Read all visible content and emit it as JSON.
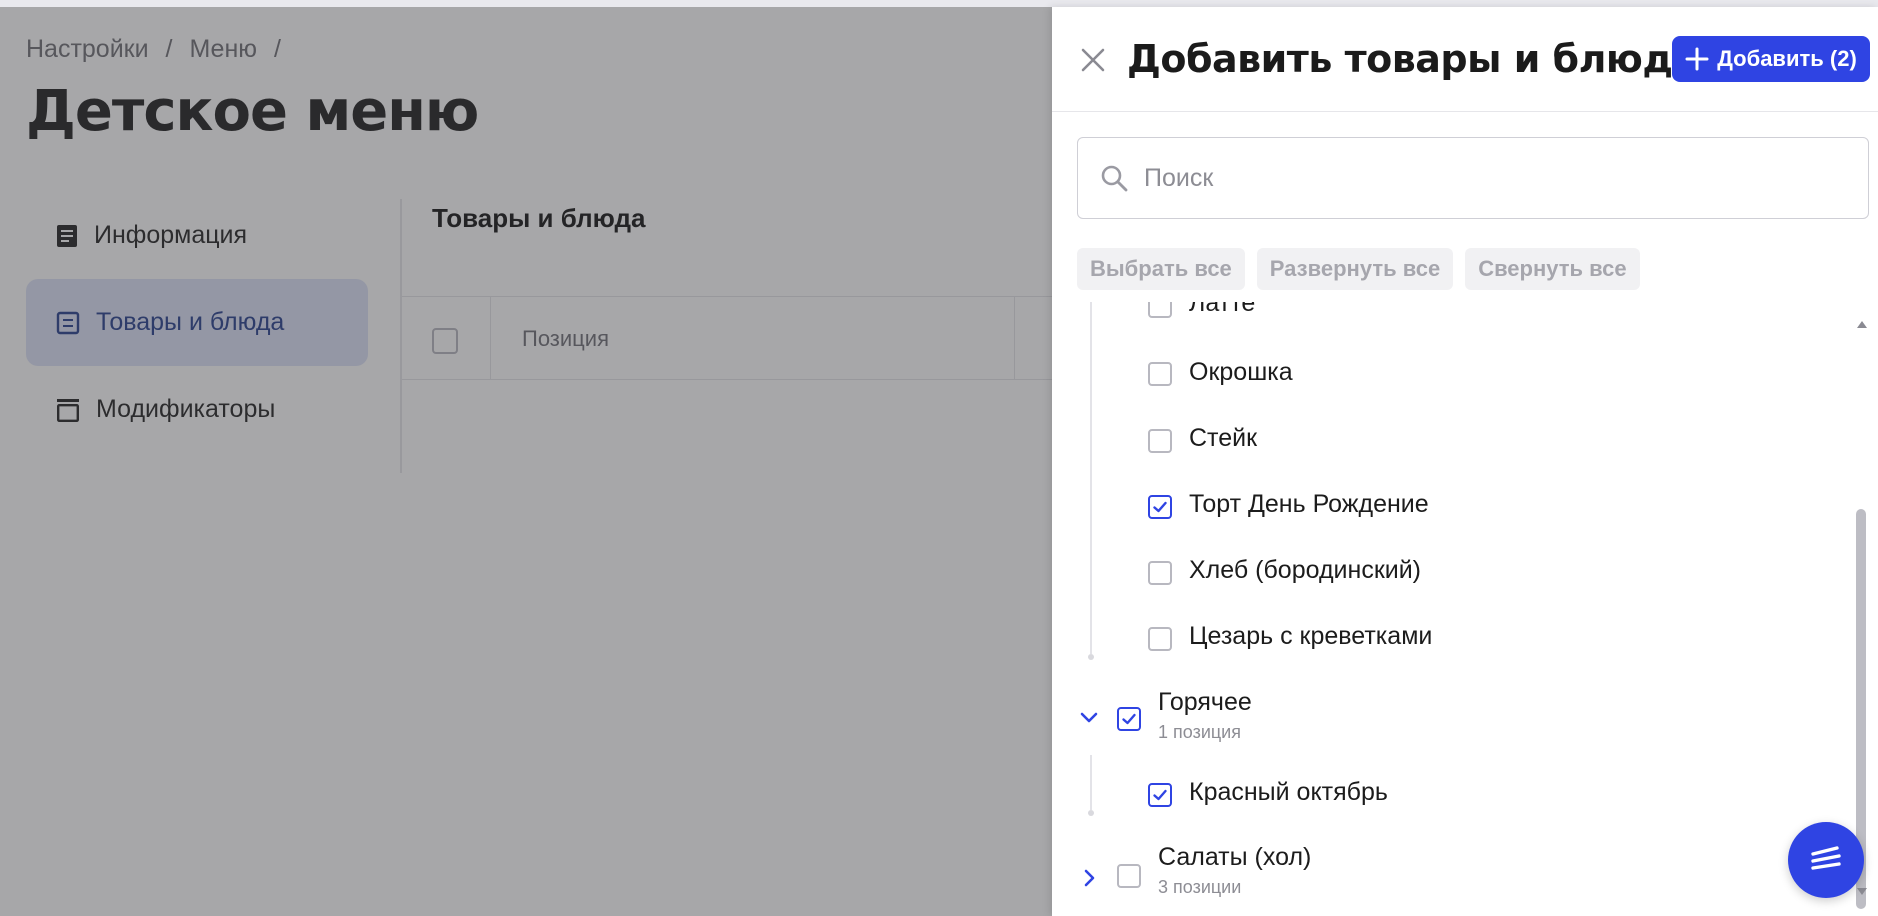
{
  "breadcrumb": {
    "item1": "Настройки",
    "sep1": "/",
    "item2": "Меню",
    "sep2": "/"
  },
  "page_title": "Детское меню",
  "sidebar": {
    "items": [
      {
        "label": "Информация",
        "icon": "document-icon",
        "active": false
      },
      {
        "label": "Товары и блюда",
        "icon": "list-icon",
        "active": true
      },
      {
        "label": "Модификаторы",
        "icon": "layers-icon",
        "active": false
      }
    ]
  },
  "main": {
    "section_title": "Товары и блюда",
    "table": {
      "columns": [
        "Позиция"
      ]
    }
  },
  "drawer": {
    "title": "Добавить товары и блюда",
    "add_button_label": "Добавить (2)",
    "search_placeholder": "Поиск",
    "pills": [
      "Выбрать все",
      "Развернуть все",
      "Свернуть все"
    ],
    "items_top": [
      {
        "label": "Латте",
        "checked": false
      },
      {
        "label": "Окрошка",
        "checked": false
      },
      {
        "label": "Стейк",
        "checked": false
      },
      {
        "label": "Торт День Рождение",
        "checked": true
      },
      {
        "label": "Хлеб (бородинский)",
        "checked": false
      },
      {
        "label": "Цезарь с креветками",
        "checked": false
      }
    ],
    "groups": [
      {
        "label": "Горячее",
        "sub": "1 позиция",
        "checked": true,
        "expanded": true,
        "items": [
          {
            "label": "Красный октябрь",
            "checked": true
          }
        ]
      },
      {
        "label": "Салаты (хол)",
        "sub": "3 позиции",
        "checked": false,
        "expanded": false,
        "items": []
      }
    ]
  },
  "colors": {
    "accent": "#2f44e3",
    "active_nav_bg": "#dde2f7",
    "overlay": "#3c3c40"
  }
}
